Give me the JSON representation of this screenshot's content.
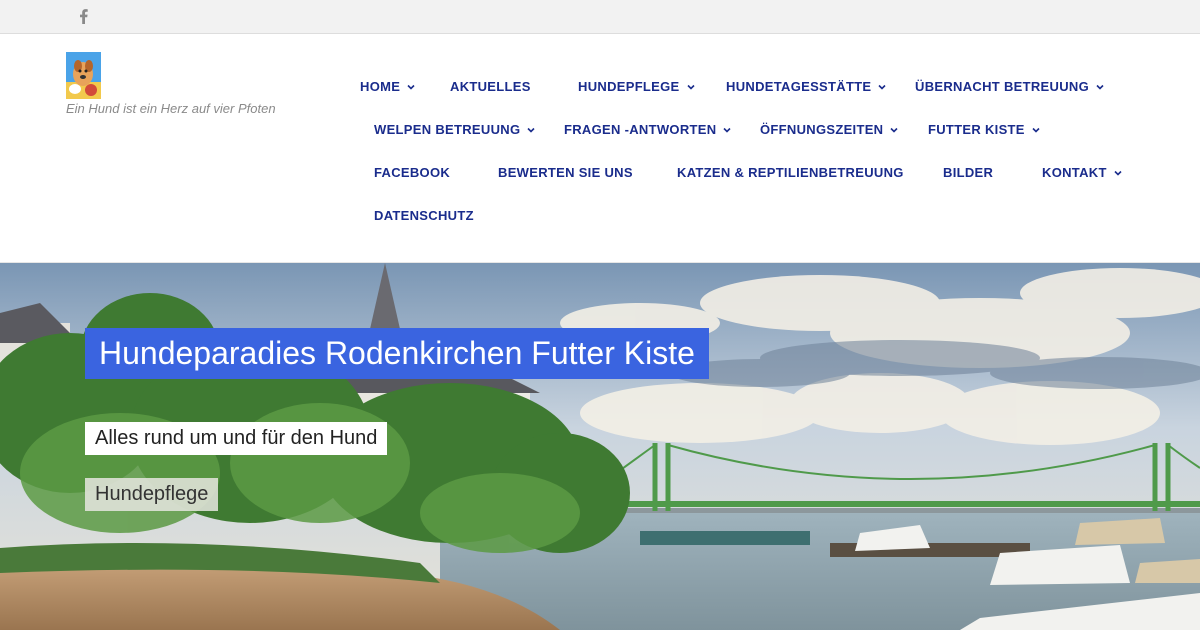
{
  "topbar": {
    "social_icon": "facebook-icon"
  },
  "header": {
    "logo_icon": "dog-logo-icon",
    "tagline": "Ein Hund ist ein Herz auf vier Pfoten"
  },
  "nav": {
    "items": [
      {
        "label": "HOME",
        "has_dropdown": true
      },
      {
        "label": "AKTUELLES",
        "has_dropdown": false
      },
      {
        "label": "HUNDEPFLEGE",
        "has_dropdown": true
      },
      {
        "label": "HUNDETAGESSTÄTTE",
        "has_dropdown": true
      },
      {
        "label": "ÜBERNACHT BETREUUNG",
        "has_dropdown": true
      },
      {
        "label": "WELPEN BETREUUNG",
        "has_dropdown": true
      },
      {
        "label": "FRAGEN -ANTWORTEN",
        "has_dropdown": true
      },
      {
        "label": "ÖFFNUNGSZEITEN",
        "has_dropdown": true
      },
      {
        "label": "FUTTER KISTE",
        "has_dropdown": true
      },
      {
        "label": "FACEBOOK",
        "has_dropdown": false
      },
      {
        "label": "BEWERTEN SIE UNS",
        "has_dropdown": false
      },
      {
        "label": "KATZEN & REPTILIENBETREUUNG",
        "has_dropdown": false
      },
      {
        "label": "BILDER",
        "has_dropdown": false
      },
      {
        "label": "KONTAKT",
        "has_dropdown": true
      },
      {
        "label": "DATENSCHUTZ",
        "has_dropdown": false
      }
    ]
  },
  "hero": {
    "title": "Hundeparadies Rodenkirchen Futter Kiste",
    "subtitle": "Alles rund um und für den Hund",
    "button_label": "Hundepflege"
  },
  "colors": {
    "nav_text": "#1a2c8c",
    "title_bg": "#3a64e0",
    "topbar_bg": "#f2f2f2"
  }
}
